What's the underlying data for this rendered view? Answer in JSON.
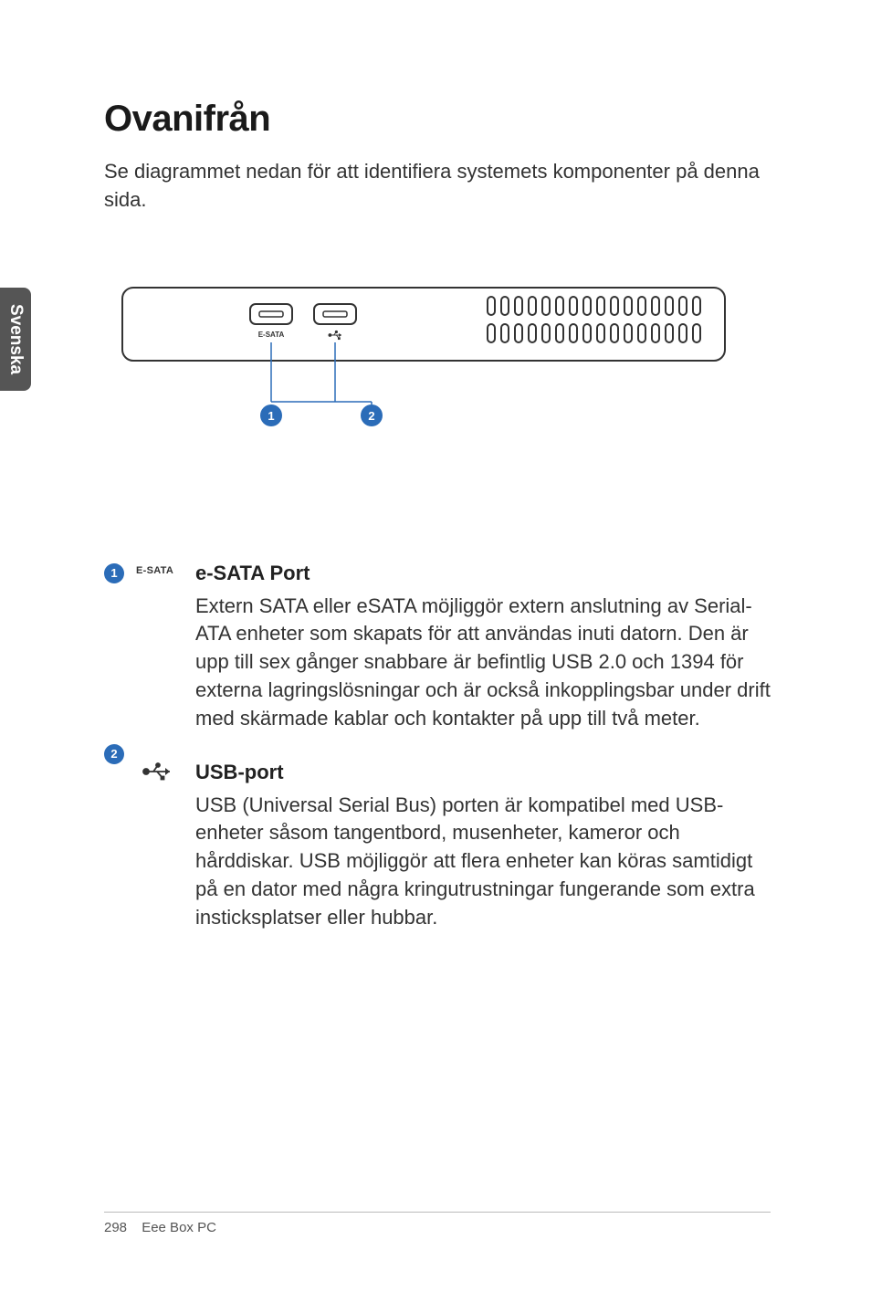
{
  "side_tab": "Svenska",
  "title": "Ovanifrån",
  "intro": "Se diagrammet nedan för att identifiera systemets komponenter på denna sida.",
  "diagram": {
    "port1_label": "E-SATA",
    "callout1": "1",
    "callout2": "2"
  },
  "items": [
    {
      "num": "1",
      "icon_text": "E-SATA",
      "title": "e-SATA Port",
      "desc": "Extern SATA eller eSATA möjliggör extern anslutning av Serial-ATA enheter som skapats för att användas inuti datorn. Den är upp till sex gånger snabbare är befintlig USB 2.0 och 1394 för externa lagringslösningar och är också inkopplingsbar under drift med skärmade kablar och kontakter på upp till två meter."
    },
    {
      "num": "2",
      "title": "USB-port",
      "desc": "USB (Universal Serial Bus) porten är kompatibel med USB-enheter såsom tangentbord, musenheter, kameror och hårddiskar. USB möjliggör att flera enheter kan köras samtidigt på en dator med några kringutrustningar fungerande som extra insticksplatser eller hubbar."
    }
  ],
  "footer": {
    "page": "298",
    "product": "Eee Box PC"
  }
}
